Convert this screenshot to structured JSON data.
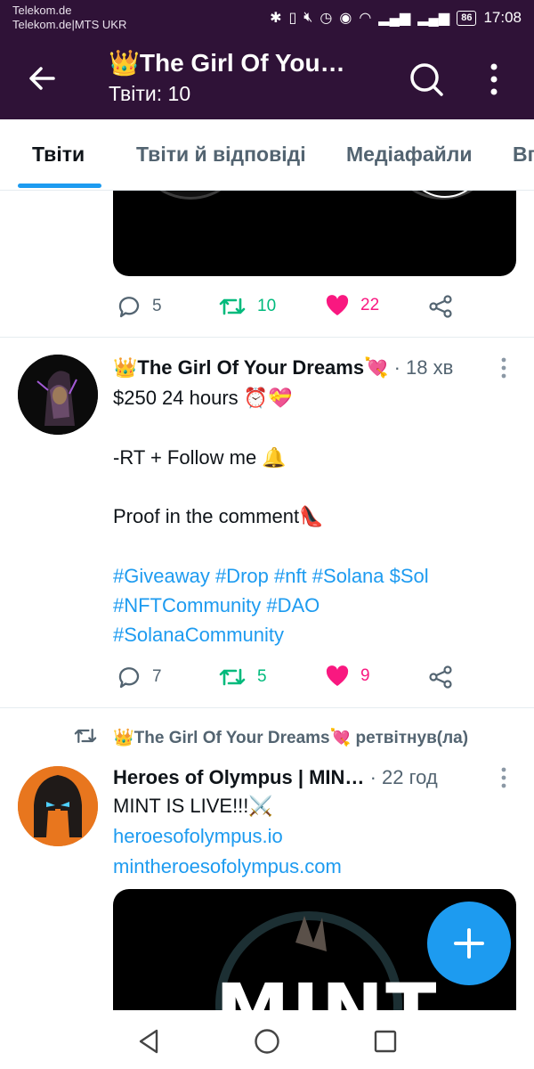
{
  "status_bar": {
    "carrier_line1": "Telekom.de",
    "carrier_line2": "Telekom.de|MTS UKR",
    "battery": "86",
    "time": "17:08"
  },
  "header": {
    "title": "👑The Girl Of You…",
    "subtitle": "Твіти: 10"
  },
  "tabs": [
    {
      "label": "Твіти",
      "active": true
    },
    {
      "label": "Твіти й відповіді",
      "active": false
    },
    {
      "label": "Медіафайли",
      "active": false
    },
    {
      "label": "Вп",
      "active": false
    }
  ],
  "tweet0": {
    "replies": "5",
    "retweets": "10",
    "likes": "22"
  },
  "tweet1": {
    "name": "👑The Girl Of Your Dreams💘",
    "time": "· 18 хв",
    "line1": "$250  24 hours ⏰💝",
    "line2": "-RT + Follow me 🔔",
    "line3": "Proof in the comment👠",
    "hashtags1": "#Giveaway #Drop #nft #Solana $Sol",
    "hashtags2": "#NFTCommunity #DAO",
    "hashtags3": "#SolanaCommunity",
    "replies": "7",
    "retweets": "5",
    "likes": "9"
  },
  "tweet2": {
    "retweet_by": "👑The Girl Of Your Dreams💘 ретвітнув(ла)",
    "name": "Heroes of Olympus | MIN…",
    "time": "· 22 год",
    "line1": "MINT IS LIVE!!!⚔️",
    "link1": "heroesofolympus.io",
    "link2": "mintheroesofolympus.com",
    "media_text": "MINT"
  },
  "colors": {
    "header_bg": "#2f1237",
    "accent": "#1d9bf0",
    "retweet": "#00ba7c",
    "like": "#f91880",
    "muted": "#536471"
  }
}
